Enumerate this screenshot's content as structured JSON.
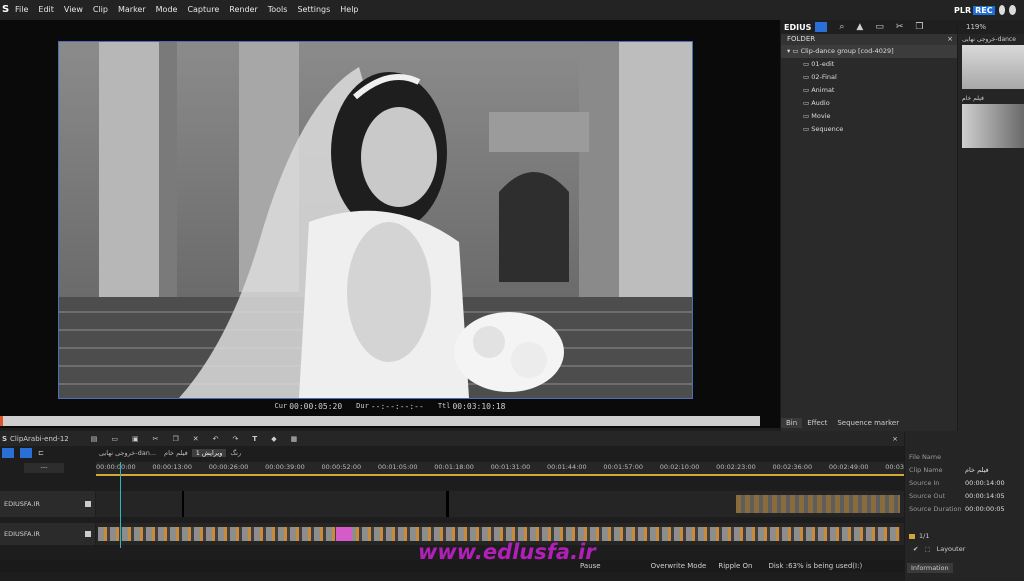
{
  "menu": {
    "items": [
      "File",
      "Edit",
      "View",
      "Clip",
      "Marker",
      "Mode",
      "Capture",
      "Render",
      "Tools",
      "Settings",
      "Help"
    ],
    "plr": "PLR",
    "rec": "REC"
  },
  "player": {
    "cur_label": "Cur",
    "cur_value": "00:00:05:20",
    "dur_label": "Dur",
    "dur_value": "--:--:--:--",
    "ttl_label": "Ttl",
    "ttl_value": "00:03:10:18"
  },
  "bin": {
    "app_label": "EDIUS",
    "folder_label": "FOLDER",
    "zoom": "119%",
    "root": "Clip-dance group [cod-4029]",
    "folders": [
      "01-edit",
      "02-Final",
      "Animat",
      "Audio",
      "Movie",
      "Sequence"
    ],
    "thumbs": [
      {
        "label": "خروجی نهایی-dance"
      },
      {
        "label": "فیلم خام"
      }
    ],
    "tabs": [
      "Bin",
      "Effect",
      "Sequence marker"
    ]
  },
  "timeline": {
    "sequence_name": "ClipArabi-end-12",
    "tabs": [
      "خروجی نهایی-dan...",
      "فیلم خام",
      "ویرایش 1",
      "رنگ"
    ],
    "ruler": [
      "00:00:00:00",
      "00:00:13:00",
      "00:00:26:00",
      "00:00:39:00",
      "00:00:52:00",
      "00:01:05:00",
      "00:01:18:00",
      "00:01:31:00",
      "00:01:44:00",
      "00:01:57:00",
      "00:02:10:00",
      "00:02:23:00",
      "00:02:36:00",
      "00:02:49:00",
      "00:03"
    ],
    "tracks": [
      "EDIUSFA.IR",
      "EDIUSFA.IR"
    ],
    "playhead_value": "---"
  },
  "status": {
    "pause": "Pause",
    "overwrite": "Overwrite Mode",
    "ripple": "Ripple On",
    "disk": "Disk :63% is being used(I:)"
  },
  "info": {
    "rows": [
      {
        "k": "File Name",
        "v": ""
      },
      {
        "k": "Clip Name",
        "v": "فیلم خام"
      },
      {
        "k": "Source In",
        "v": "00:00:14:00"
      },
      {
        "k": "Source Out",
        "v": "00:00:14:05"
      },
      {
        "k": "Source Duration",
        "v": "00:00:00:05"
      }
    ],
    "page": "1/1",
    "layouter": "Layouter",
    "tab": "Information"
  },
  "watermark": "www.edlusfa.ir",
  "colors": {
    "accent": "#2a6fd6",
    "rec": "#1f6ed4",
    "frame_border": "#4e6fb5",
    "watermark": "#b11fb8",
    "play": "#3cc43c"
  }
}
